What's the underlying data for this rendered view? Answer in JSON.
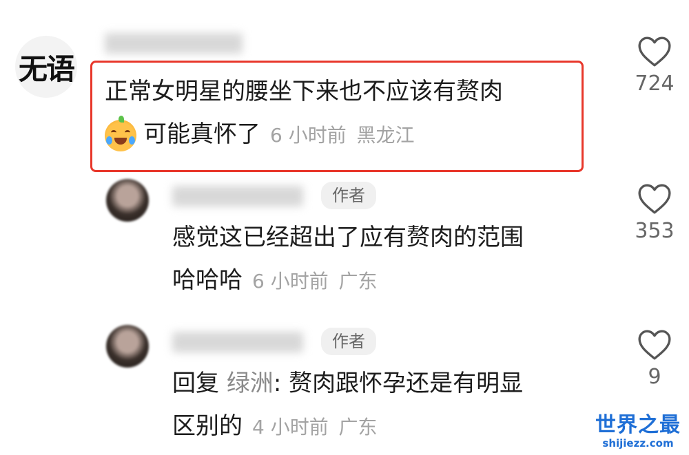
{
  "comments": [
    {
      "avatar_text": "无语",
      "line1": "正常女明星的腰坐下来也不应该有赘肉",
      "line2": "可能真怀了",
      "time": "6 小时前",
      "location": "黑龙江",
      "likes": "724"
    },
    {
      "tag": "作者",
      "line1": "感觉这已经超出了应有赘肉的范围",
      "line2": "哈哈哈",
      "time": "6 小时前",
      "location": "广东",
      "likes": "353"
    },
    {
      "tag": "作者",
      "reply_prefix": "回复",
      "reply_to": "绿洲",
      "line1": ": 赘肉跟怀孕还是有明显",
      "line2": "区别的",
      "time": "4 小时前",
      "location": "广东",
      "likes": "9"
    }
  ],
  "watermark": {
    "main": "世界之最",
    "sub": "shijiezz.com"
  },
  "colors": {
    "highlight": "#e8372b",
    "watermark": "#1f6fd6"
  },
  "icons": {
    "like": "heart-outline-icon",
    "emoji": "crying-laughing-emoji"
  }
}
